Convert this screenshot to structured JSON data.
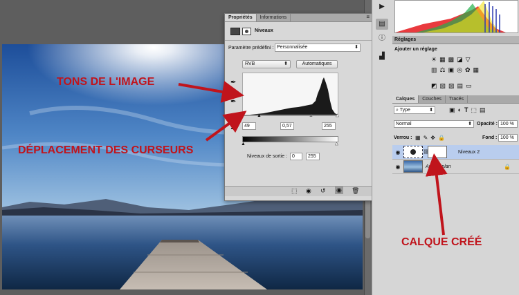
{
  "annotations": {
    "tons": "TONS DE L'IMAGE",
    "deplacement": "DÉPLACEMENT DES CURSEURS",
    "calque": "CALQUE CRÉÉ",
    "color": "#c0141c"
  },
  "properties": {
    "tabs": [
      "Propriétés",
      "Informations"
    ],
    "title": "Niveaux",
    "preset_label": "Paramètre prédéfini :",
    "preset_value": "Personnalisée",
    "channel": "RVB",
    "auto_button": "Automatiques",
    "input_black": "49",
    "input_gamma": "0,57",
    "input_white": "255",
    "output_label": "Niveaux de sortie :",
    "output_black": "0",
    "output_white": "255"
  },
  "adjustments": {
    "header": "Réglages",
    "add_label": "Ajouter un réglage"
  },
  "layers": {
    "tabs": [
      "Calques",
      "Couches",
      "Tracés"
    ],
    "filter": "Type",
    "blend_mode": "Normal",
    "opacity_label": "Opacité :",
    "opacity_value": "100 %",
    "lock_label": "Verrou :",
    "fill_label": "Fond :",
    "fill_value": "100 %",
    "items": [
      {
        "name": "Niveaux 2"
      },
      {
        "name": "Arrière-plan"
      }
    ]
  }
}
